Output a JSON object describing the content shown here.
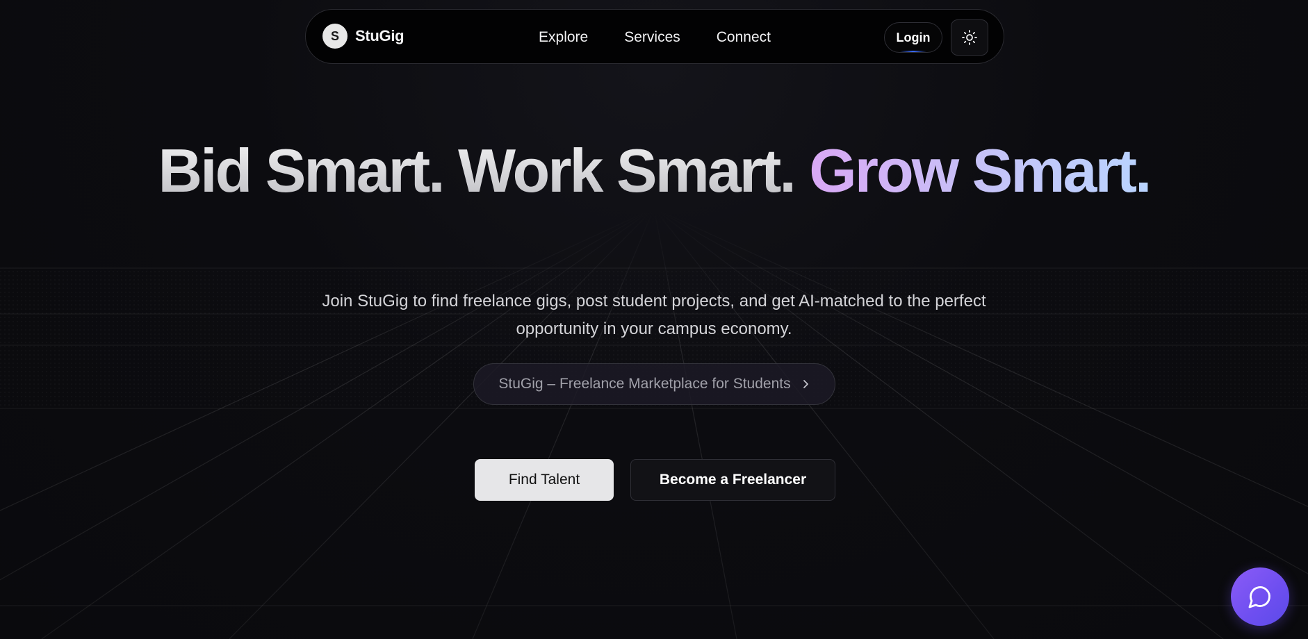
{
  "brand": {
    "logo_letter": "S",
    "name": "StuGig"
  },
  "nav": {
    "links": [
      "Explore",
      "Services",
      "Connect"
    ],
    "login_label": "Login",
    "theme_toggle_icon": "sun-icon"
  },
  "hero": {
    "headline_part1": "Bid Smart. Work Smart. ",
    "headline_accent": "Grow Smart.",
    "subtext_line1": "Join StuGig to find freelance gigs, post student projects, and get AI-matched to the perfect",
    "subtext_line2": "opportunity in your campus economy.",
    "pill_label": "StuGig – Freelance Marketplace for Students",
    "pill_icon": "chevron-right-icon",
    "primary_cta": "Find Talent",
    "secondary_cta": "Become a Freelancer"
  },
  "chat": {
    "icon": "chat-bubble-icon"
  },
  "colors": {
    "background": "#0b0b0e",
    "accent_gradient_start": "#d9a8f5",
    "accent_gradient_end": "#b9d4ff",
    "chat_button": "#7c55f2"
  }
}
